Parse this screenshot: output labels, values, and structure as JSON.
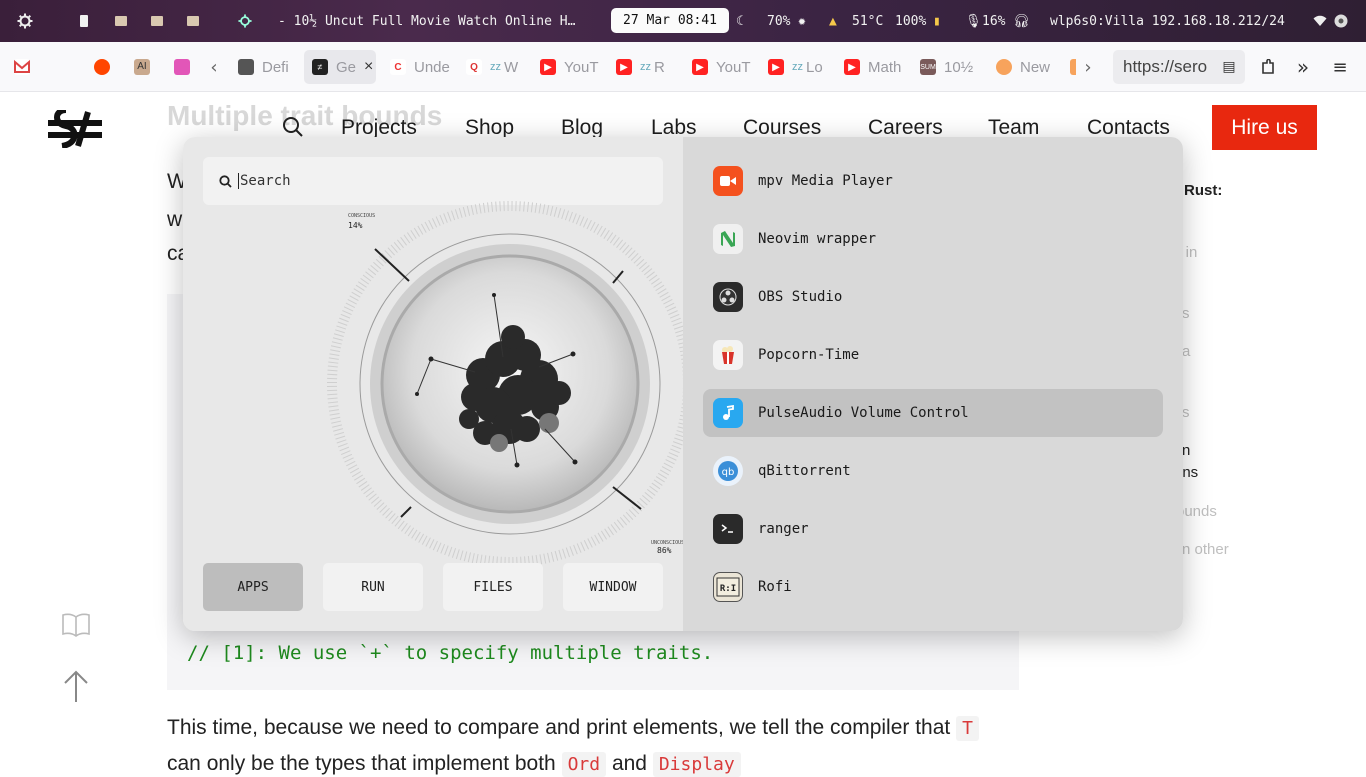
{
  "sysbar": {
    "window_title": "- 10½ Uncut Full Movie Watch Online H…",
    "clock": "27 Mar 08:41",
    "brightness": "70%",
    "temperature": "51°C",
    "battery": "100%",
    "mic_volume": "16%",
    "network": "wlp6s0:Villa 192.168.18.212/24"
  },
  "tabs": [
    {
      "label": "Defi"
    },
    {
      "label": "Ge"
    },
    {
      "label": "Unde"
    },
    {
      "label": "W"
    },
    {
      "label": "YouT"
    },
    {
      "label": "R"
    },
    {
      "label": "YouT"
    },
    {
      "label": "Lo"
    },
    {
      "label": "Math"
    },
    {
      "label": "10½"
    },
    {
      "label": "New"
    }
  ],
  "url": "https://sero",
  "nav": {
    "items": [
      "Projects",
      "Shop",
      "Blog",
      "Labs",
      "Courses",
      "Careers",
      "Team",
      "Contacts"
    ],
    "hire": "Hire us"
  },
  "article": {
    "heading": "Multiple trait bounds",
    "line1_start": "W",
    "line2_start": "w",
    "line3_start": "ca",
    "code_comment": "// [1]: We use `+` to specify multiple traits.",
    "para2_a": "This time, because we need to compare and print elements, we tell the compiler that",
    "para2_t": "T",
    "para2_b": "can only be the types that implement both",
    "para2_ord": "Ord",
    "para2_and": "and",
    "para2_display": "Display"
  },
  "toc": {
    "items": [
      "Rust:",
      "s in",
      "s",
      "a",
      "s",
      "n",
      "ons",
      "ounds",
      "n other"
    ]
  },
  "rofi": {
    "search_placeholder": "Search",
    "art_top_label": "CONSCIOUS",
    "art_top_value": "14%",
    "art_bottom_label": "UNCONSCIOUS",
    "art_bottom_value": "86%",
    "modes": [
      "APPS",
      "RUN",
      "FILES",
      "WINDOW"
    ],
    "selected_mode": "APPS",
    "apps": [
      {
        "name": "mpv Media Player",
        "icon": "mpv-icon",
        "color": "#f4511e"
      },
      {
        "name": "Neovim wrapper",
        "icon": "neovim-icon",
        "color": "#f0f0f0"
      },
      {
        "name": "OBS Studio",
        "icon": "obs-icon",
        "color": "#2b2b2b"
      },
      {
        "name": "Popcorn-Time",
        "icon": "popcorn-icon",
        "color": "#f3f3f3"
      },
      {
        "name": "PulseAudio Volume Control",
        "icon": "pulseaudio-icon",
        "color": "#29a8f0"
      },
      {
        "name": "qBittorrent",
        "icon": "qbittorrent-icon",
        "color": "#eaf2fb"
      },
      {
        "name": "ranger",
        "icon": "terminal-icon",
        "color": "#2a2a2a"
      },
      {
        "name": "Rofi",
        "icon": "rofi-icon",
        "color": "#ebe5d6"
      }
    ],
    "selected_app": "PulseAudio Volume Control"
  }
}
